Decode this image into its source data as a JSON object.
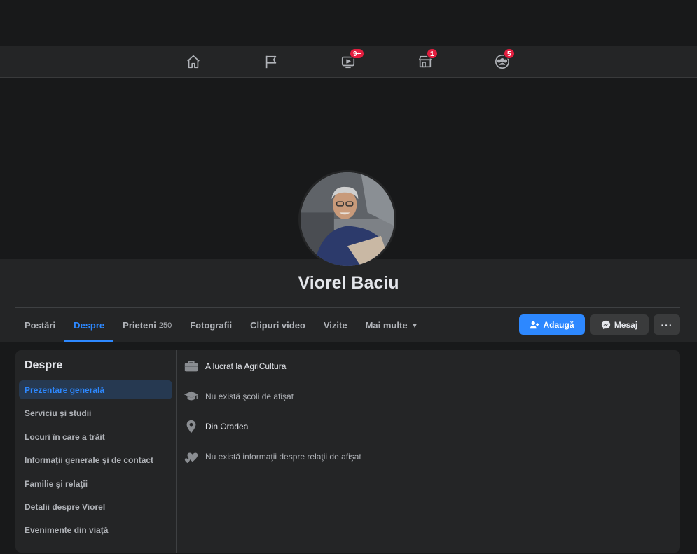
{
  "topnav": {
    "items": [
      {
        "name": "home",
        "badge": ""
      },
      {
        "name": "pages",
        "badge": ""
      },
      {
        "name": "watch",
        "badge": "9+"
      },
      {
        "name": "marketplace",
        "badge": "1"
      },
      {
        "name": "groups",
        "badge": "5"
      }
    ]
  },
  "profile": {
    "name": "Viorel Baciu"
  },
  "tabs": {
    "posts": "Postări",
    "about": "Despre",
    "friends": "Prieteni",
    "friends_count": "250",
    "photos": "Fotografii",
    "videos": "Clipuri video",
    "checkins": "Vizite",
    "more": "Mai multe"
  },
  "actions": {
    "add": "Adaugă",
    "message": "Mesaj",
    "more": "···"
  },
  "about": {
    "title": "Despre",
    "nav": [
      "Prezentare generală",
      "Serviciu şi studii",
      "Locuri în care a trăit",
      "Informaţii generale şi de contact",
      "Familie şi relaţii",
      "Detalii despre Viorel",
      "Evenimente din viaţă"
    ],
    "overview": {
      "work": "A lucrat la AgriCultura",
      "education": "Nu există şcoli de afişat",
      "hometown": "Din Oradea",
      "relationship": "Nu există informaţii despre relaţii de afişat"
    }
  },
  "colors": {
    "accent": "#2d88ff",
    "badge": "#e41e3f",
    "surface": "#242526",
    "background": "#18191a"
  }
}
